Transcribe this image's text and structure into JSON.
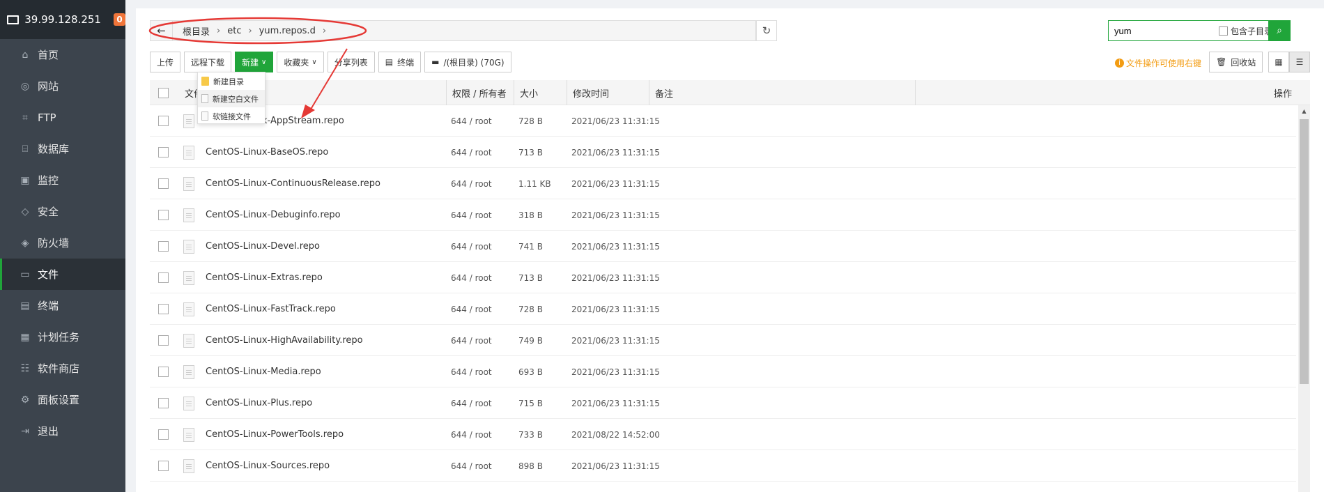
{
  "sidebar": {
    "host": "39.99.128.251",
    "badge": "0",
    "items": [
      {
        "label": "首页",
        "icon": "home-icon"
      },
      {
        "label": "网站",
        "icon": "globe-icon"
      },
      {
        "label": "FTP",
        "icon": "ftp-icon"
      },
      {
        "label": "数据库",
        "icon": "database-icon"
      },
      {
        "label": "监控",
        "icon": "monitor-icon"
      },
      {
        "label": "安全",
        "icon": "shield-icon"
      },
      {
        "label": "防火墙",
        "icon": "firewall-icon"
      },
      {
        "label": "文件",
        "icon": "folder-icon"
      },
      {
        "label": "终端",
        "icon": "terminal-icon"
      },
      {
        "label": "计划任务",
        "icon": "calendar-icon"
      },
      {
        "label": "软件商店",
        "icon": "apps-icon"
      },
      {
        "label": "面板设置",
        "icon": "gear-icon"
      },
      {
        "label": "退出",
        "icon": "logout-icon"
      }
    ],
    "active_index": 7
  },
  "path": {
    "crumbs": [
      "根目录",
      "etc",
      "yum.repos.d"
    ]
  },
  "search": {
    "value": "yum",
    "subdir_label": "包含子目录"
  },
  "toolbar": {
    "upload": "上传",
    "remote_download": "远程下载",
    "new": "新建",
    "favorites": "收藏夹",
    "share_list": "分享列表",
    "terminal": "终端",
    "disk": "/(根目录) (70G)",
    "tip": "文件操作可使用右键",
    "recycle": "回收站"
  },
  "new_menu": {
    "items": [
      "新建目录",
      "新建空白文件",
      "软链接文件"
    ]
  },
  "table": {
    "headers": {
      "name": "文件名",
      "perm": "权限 / 所有者",
      "size": "大小",
      "mtime": "修改时间",
      "note": "备注",
      "action": "操作"
    },
    "rows": [
      {
        "name": "CentOS-Linux-AppStream.repo",
        "perm": "644 / root",
        "size": "728 B",
        "mtime": "2021/06/23 11:31:15"
      },
      {
        "name": "CentOS-Linux-BaseOS.repo",
        "perm": "644 / root",
        "size": "713 B",
        "mtime": "2021/06/23 11:31:15"
      },
      {
        "name": "CentOS-Linux-ContinuousRelease.repo",
        "perm": "644 / root",
        "size": "1.11 KB",
        "mtime": "2021/06/23 11:31:15"
      },
      {
        "name": "CentOS-Linux-Debuginfo.repo",
        "perm": "644 / root",
        "size": "318 B",
        "mtime": "2021/06/23 11:31:15"
      },
      {
        "name": "CentOS-Linux-Devel.repo",
        "perm": "644 / root",
        "size": "741 B",
        "mtime": "2021/06/23 11:31:15"
      },
      {
        "name": "CentOS-Linux-Extras.repo",
        "perm": "644 / root",
        "size": "713 B",
        "mtime": "2021/06/23 11:31:15"
      },
      {
        "name": "CentOS-Linux-FastTrack.repo",
        "perm": "644 / root",
        "size": "728 B",
        "mtime": "2021/06/23 11:31:15"
      },
      {
        "name": "CentOS-Linux-HighAvailability.repo",
        "perm": "644 / root",
        "size": "749 B",
        "mtime": "2021/06/23 11:31:15"
      },
      {
        "name": "CentOS-Linux-Media.repo",
        "perm": "644 / root",
        "size": "693 B",
        "mtime": "2021/06/23 11:31:15"
      },
      {
        "name": "CentOS-Linux-Plus.repo",
        "perm": "644 / root",
        "size": "715 B",
        "mtime": "2021/06/23 11:31:15"
      },
      {
        "name": "CentOS-Linux-PowerTools.repo",
        "perm": "644 / root",
        "size": "733 B",
        "mtime": "2021/08/22 14:52:00"
      },
      {
        "name": "CentOS-Linux-Sources.repo",
        "perm": "644 / root",
        "size": "898 B",
        "mtime": "2021/06/23 11:31:15"
      }
    ]
  },
  "colors": {
    "accent": "#20a53a",
    "sidebar_bg": "#3c444d",
    "annotation": "#e53935",
    "tip": "#f39c12"
  }
}
